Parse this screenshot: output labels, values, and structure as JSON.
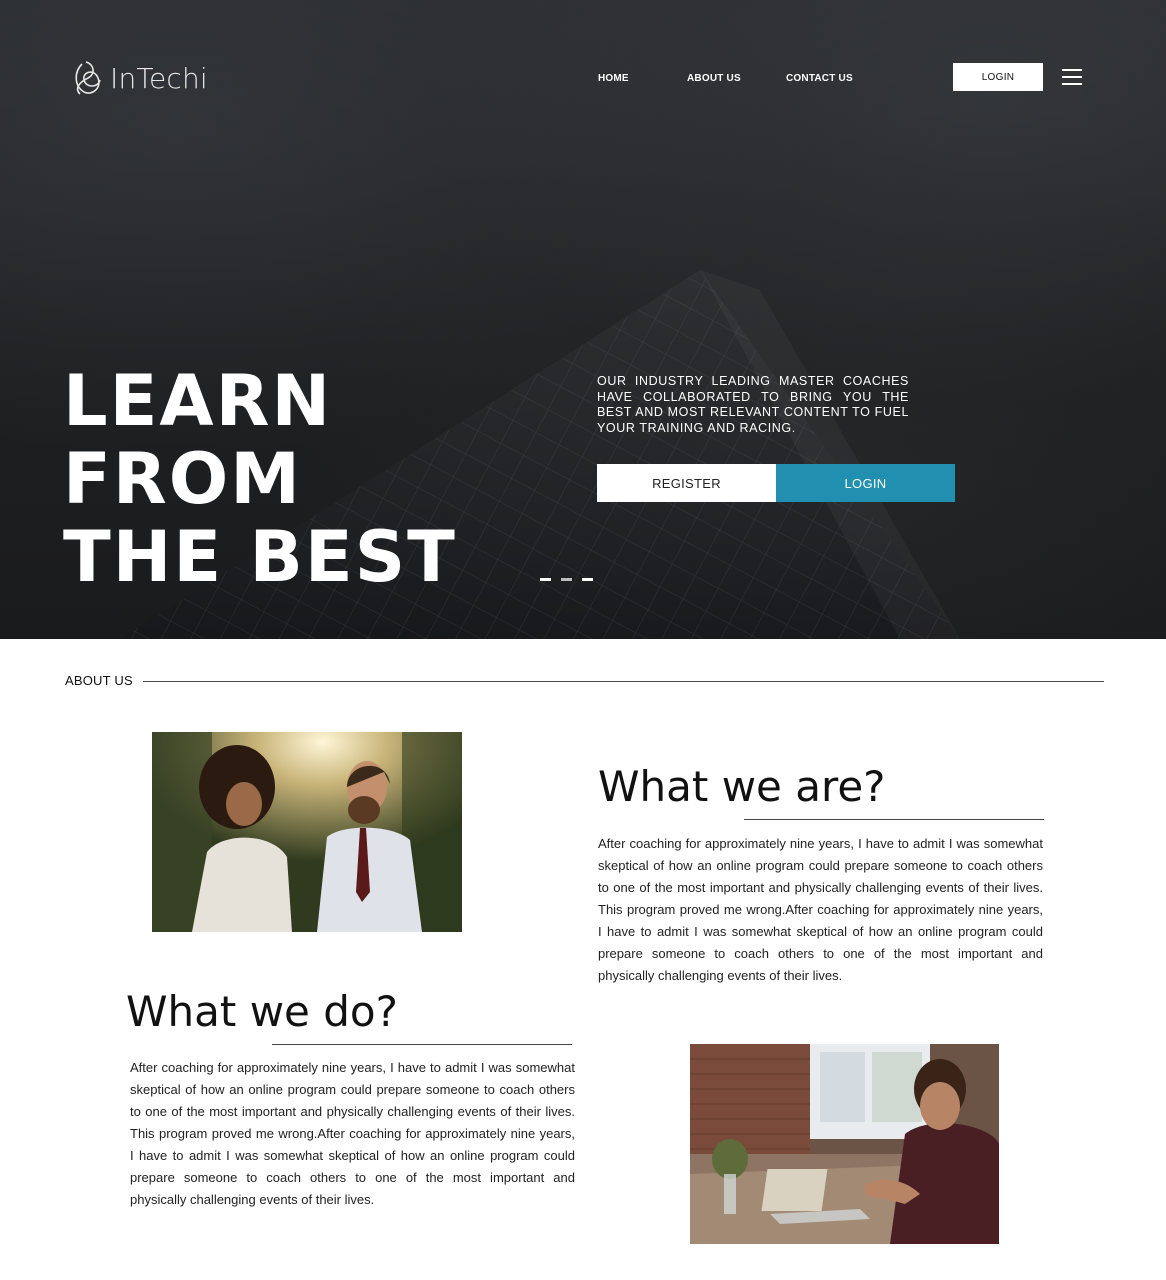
{
  "brand": {
    "name": "InTechi"
  },
  "nav": {
    "items": [
      "HOME",
      "ABOUT US",
      "CONTACT US"
    ],
    "login_label": "LOGIN"
  },
  "hero": {
    "title_line1": "LEARN FROM",
    "title_line2": "THE BEST",
    "tagline": "OUR INDUSTRY LEADING MASTER COACHES HAVE COLLABORATED TO BRING YOU THE BEST AND MOST RELEVANT CONTENT TO FUEL YOUR TRAINING AND RACING.",
    "register_label": "REGISTER",
    "login_label": "LOGIN",
    "slides_total": 3,
    "slide_active": 1
  },
  "about": {
    "section_label": "ABOUT US",
    "what_we_are": {
      "heading": "What we are?",
      "text": "After coaching for approximately nine years, I have to admit I was somewhat skeptical of how an online program could prepare someone to coach others to one of the most important and physically challenging events of their lives. This program proved me wrong.After coaching for approximately nine years, I have to admit I was somewhat skeptical of how an online program could prepare someone to coach others to one of the most important and physically challenging events of their lives."
    },
    "what_we_do": {
      "heading": "What we do?",
      "text": "After coaching for approximately nine years, I have to admit I was somewhat skeptical of how an online program could prepare someone to coach others to one of the most important and physically challenging events of their lives. This program proved me wrong.After coaching for approximately nine years, I have to admit I was somewhat skeptical of how an online program could prepare someone to coach others to one of the most important and physically challenging events of their lives."
    }
  },
  "colors": {
    "accent": "#2190b0",
    "hero_overlay": "#1f2022",
    "text": "#111111"
  },
  "icons": [
    "logo-knot-icon",
    "hamburger-menu-icon"
  ]
}
